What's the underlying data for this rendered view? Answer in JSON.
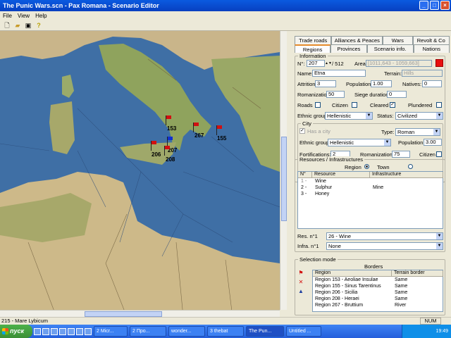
{
  "window": {
    "title": "The Punic Wars.scn - Pax Romana - Scenario Editor",
    "min": "_",
    "max": "□",
    "close": "×"
  },
  "menu": [
    "File",
    "View",
    "Help"
  ],
  "toolbar": {
    "new_icon": "new-file-icon",
    "open_icon": "open-folder-icon",
    "save_icon": "save-disk-icon",
    "help_icon": "help-question-icon"
  },
  "map": {
    "flags": [
      {
        "label": "153",
        "color": "#d21010"
      },
      {
        "label": "267",
        "color": "#d21010"
      },
      {
        "label": "155",
        "color": "#d21010"
      },
      {
        "label": "206",
        "color": "#d21010"
      },
      {
        "label": "207",
        "color": "#1030d0"
      },
      {
        "label": "208",
        "color": "#d21010"
      }
    ]
  },
  "tabs_row1": [
    "Trade roads",
    "Alliances & Peaces",
    "Wars",
    "Revolt & Co"
  ],
  "tabs_row2": [
    "Regions",
    "Provinces",
    "Scenario info.",
    "Nations"
  ],
  "information": {
    "title": "Information",
    "n_label": "N°:",
    "n_value": "207",
    "n_total": "/ 512",
    "area_label": "Area:",
    "area_value": "[1011,643 - 1059,663]",
    "name_label": "Name:",
    "name_value": "Etna",
    "terrain_label": "Terrain:",
    "terrain_value": "Hills",
    "attrition_label": "Attrition:",
    "attrition_value": "3",
    "population_label": "Population:",
    "population_value": "1.00",
    "natives_label": "Natives:",
    "natives_value": "0",
    "romanization_label": "Romanization:",
    "romanization_value": "50",
    "siege_label": "Siege duration:",
    "siege_value": "0",
    "roads_label": "Roads",
    "citizen_label": "Citizen",
    "cleared_label": "Cleared",
    "plundered_label": "Plundered",
    "ethnic_label": "Ethnic group:",
    "ethnic_value": "Hellenistic",
    "status_label": "Status:",
    "status_value": "Civilized"
  },
  "city": {
    "title": "City",
    "has_city_label": "Has a city",
    "type_label": "Type:",
    "type_value": "Roman",
    "ethnic_label": "Ethnic group:",
    "ethnic_value": "Hellenistic",
    "population_label": "Population:",
    "population_value": "3.00",
    "fortifications_label": "Fortifications:",
    "fortifications_value": "2",
    "romanization_label": "Romanization:",
    "romanization_value": "75",
    "citizen_label": "Citizen"
  },
  "resources": {
    "title": "Resources / Infrastructures",
    "region_label": "Region",
    "town_label": "Town",
    "headers": [
      "N°",
      "Resource",
      "Infrastructure"
    ],
    "rows": [
      {
        "n": "1 -",
        "resource": "Wine",
        "infra": ""
      },
      {
        "n": "2 -",
        "resource": "Sulphur",
        "infra": "Mine"
      },
      {
        "n": "3 -",
        "resource": "Honey",
        "infra": ""
      }
    ],
    "res_label": "Res. n°1",
    "res_value": "26 - Wine",
    "infra_label": "Infra. n°1",
    "infra_value": "None"
  },
  "selection": {
    "title": "Selection mode",
    "borders_label": "Borders",
    "headers": [
      "Region",
      "Terrain border"
    ],
    "rows": [
      {
        "region": "Region 153 - Aeoliae Insulae",
        "border": "Same"
      },
      {
        "region": "Region 155 - Sinus Tarentinus",
        "border": "Same"
      },
      {
        "region": "Region 206 - Sicilia",
        "border": "Same"
      },
      {
        "region": "Region 208 - Heraei",
        "border": "Same"
      },
      {
        "region": "Region 267 - Bruttium",
        "border": "River"
      }
    ]
  },
  "status": {
    "text": "215 - Mare Lybicum",
    "num": "NUM"
  },
  "taskbar": {
    "start": "пуск",
    "tasks": [
      "2 Micr...",
      "2 Про...",
      "wonder...",
      "3 thebat",
      "The Pun...",
      "Untitled ..."
    ],
    "clock": "19:49"
  }
}
